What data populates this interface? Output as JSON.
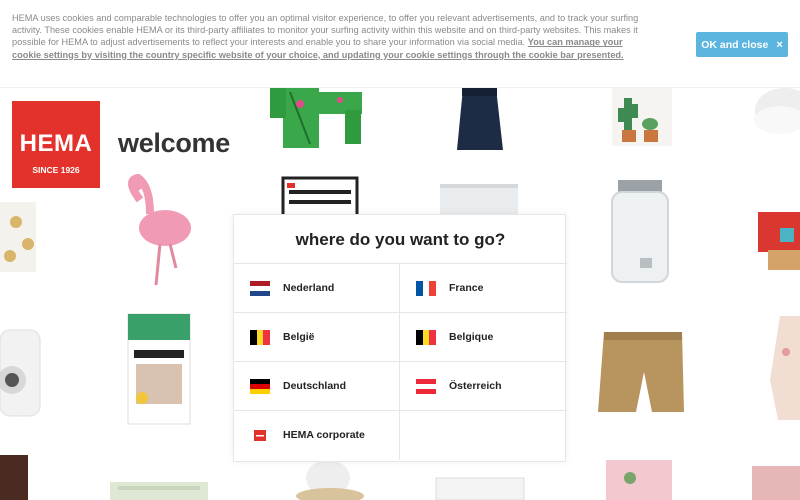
{
  "cookie_bar": {
    "text": "HEMA uses cookies and comparable technologies to offer you an optimal visitor experience, to offer you relevant advertisements, and to track your surfing activity. These cookies enable HEMA or its third-party affiliates to monitor your surfing activity within this website and on third-party websites. This makes it possible for HEMA to adjust advertisements to reflect your interests and enable you to share your information via social media.",
    "link_text": "You can manage your cookie settings by visiting the country specific website of your choice, and updating your cookie settings through the cookie bar presented.",
    "ok_label": "OK and close",
    "close_symbol": "×"
  },
  "logo": {
    "word": "HEMA",
    "since": "SINCE 1926"
  },
  "welcome": "welcome",
  "selector": {
    "title": "where do you want to go?",
    "countries": [
      {
        "label": "Nederland",
        "flag": "nl-flag-icon"
      },
      {
        "label": "France",
        "flag": "fr-flag-icon"
      },
      {
        "label": "België",
        "flag": "be-flag-icon"
      },
      {
        "label": "Belgique",
        "flag": "be-flag-icon"
      },
      {
        "label": "Deutschland",
        "flag": "de-flag-icon"
      },
      {
        "label": "Österreich",
        "flag": "at-flag-icon"
      },
      {
        "label": "HEMA corporate",
        "flag": "hema-logo-icon"
      }
    ]
  },
  "colors": {
    "brand_red": "#e3322b",
    "button_blue": "#5bb5de",
    "text_dark": "#222222",
    "text_muted": "#8a8a8a"
  }
}
